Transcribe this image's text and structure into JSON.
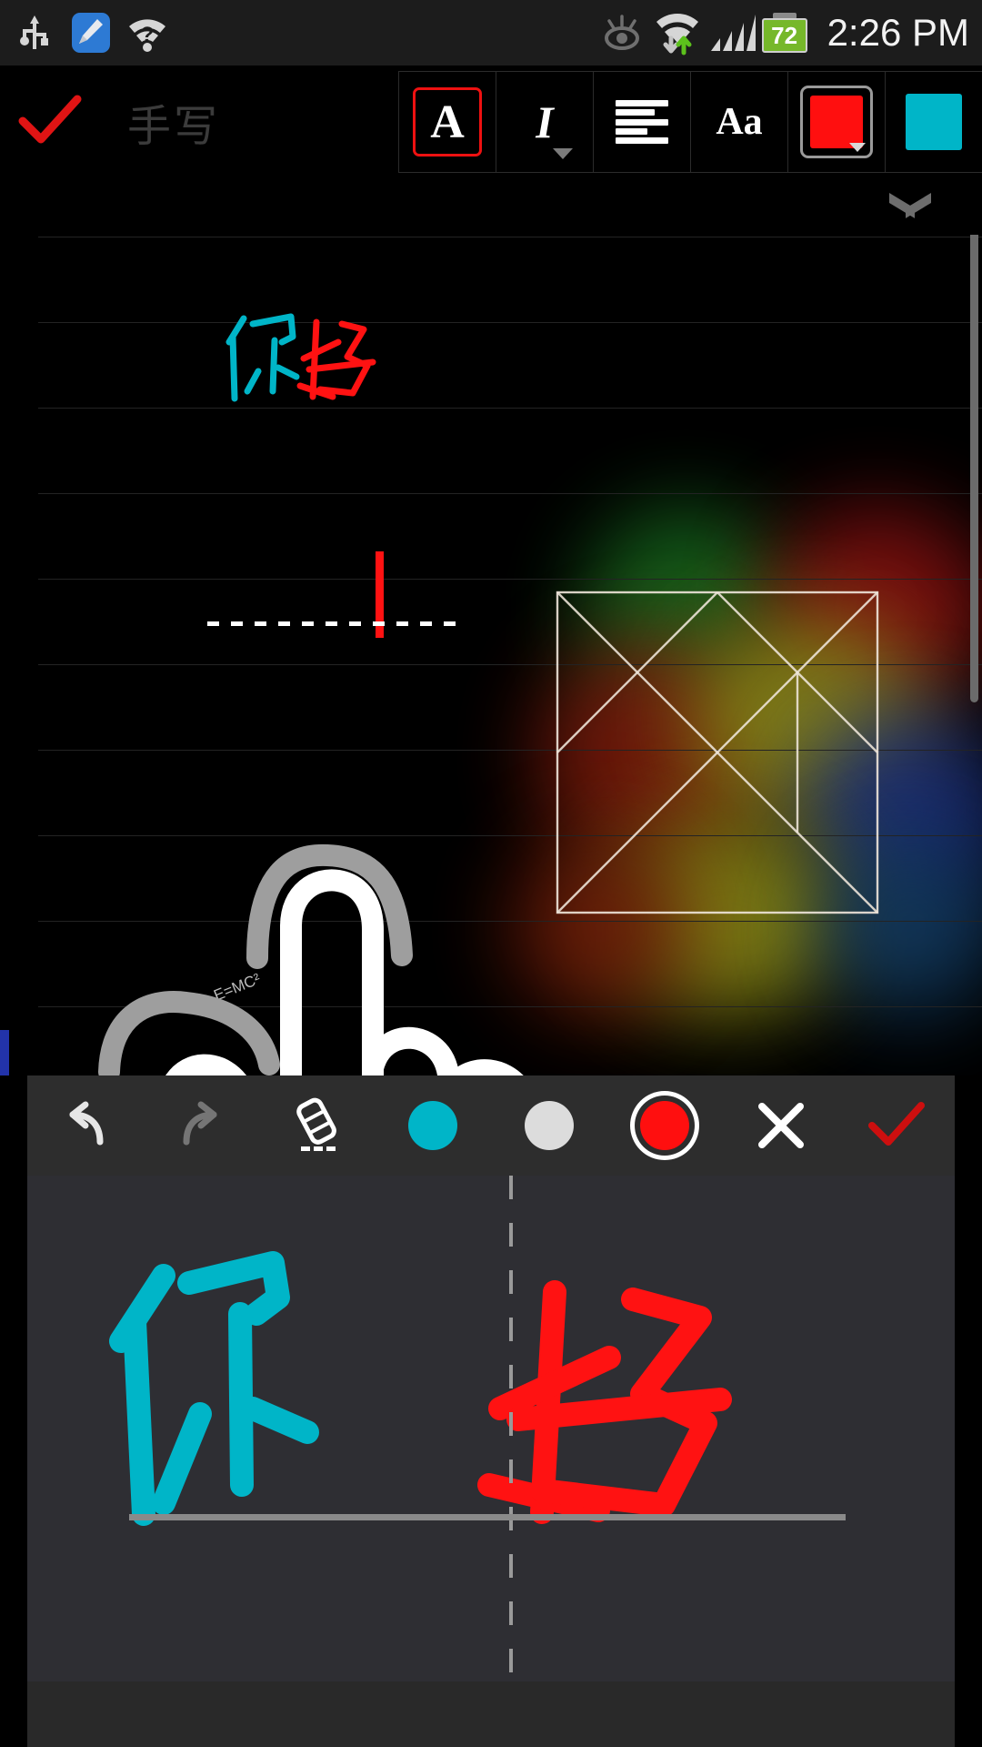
{
  "status_bar": {
    "time": "2:26 PM",
    "battery_level": "72",
    "icons": [
      {
        "name": "usb-icon",
        "label": "USB connected"
      },
      {
        "name": "cleanup-icon",
        "label": "Cleaner app"
      },
      {
        "name": "wifi-question-icon",
        "label": "Wi-Fi unknown"
      },
      {
        "name": "smart-stay-eye-icon",
        "label": "Smart stay"
      },
      {
        "name": "wifi-transfer-icon",
        "label": "Wi-Fi data transfer"
      },
      {
        "name": "signal-bars-icon",
        "label": "Mobile signal"
      },
      {
        "name": "battery-icon",
        "label": "Battery 72%"
      }
    ]
  },
  "toolbar": {
    "confirm_label": "✓",
    "title": "手写",
    "buttons": [
      {
        "name": "text-style-button",
        "glyph": "A",
        "selected": true
      },
      {
        "name": "italic-style-button",
        "glyph": "I",
        "selected": false
      },
      {
        "name": "align-button",
        "glyph": "align",
        "selected": false
      },
      {
        "name": "font-size-button",
        "glyph": "Aa",
        "selected": false
      },
      {
        "name": "text-color-swatch",
        "glyph": "",
        "selected": false,
        "color": "#ff0f0f"
      },
      {
        "name": "highlight-color-swatch",
        "glyph": "",
        "selected": false,
        "color": "#00b5c8"
      }
    ],
    "collapse_icon": "chevron-down-icon"
  },
  "canvas": {
    "handwritten_text": "你好",
    "ink_colors": {
      "first_char": "#00b5c8",
      "second_char": "#ff1212"
    },
    "cursor_color": "#ff1212",
    "underline_style": "dotted",
    "small_annotation": "E=MC²",
    "drawing": "hand-pointing-illustration",
    "stroke_colors": {
      "primary": "#ffffff",
      "secondary": "#a0a0a0"
    },
    "shape_overlay": "tangram-square-outline",
    "shape_stroke": "#efe6da",
    "rule_color": "#232323",
    "left_marker_color": "#2233aa"
  },
  "handwriting_panel": {
    "tools": [
      {
        "name": "undo-button",
        "icon": "undo-icon"
      },
      {
        "name": "redo-button",
        "icon": "redo-icon"
      },
      {
        "name": "eraser-button",
        "icon": "eraser-icon"
      },
      {
        "name": "pen-color-cyan",
        "icon": "color-dot",
        "color": "#00b5c8",
        "selected": false
      },
      {
        "name": "pen-color-white",
        "icon": "color-dot",
        "color": "#dcdcdc",
        "selected": false
      },
      {
        "name": "pen-color-red",
        "icon": "color-dot",
        "color": "#ff0f0f",
        "selected": true
      },
      {
        "name": "close-button",
        "icon": "close-icon"
      },
      {
        "name": "accept-button",
        "icon": "check-icon",
        "color": "#cc0f0f"
      }
    ],
    "pad": {
      "left_char": "你",
      "right_char": "好",
      "left_color": "#00b5c8",
      "right_color": "#ff1212",
      "background": "#2e2e33",
      "divider_style": "dashed",
      "baseline_color": "#8a8a8a"
    }
  }
}
